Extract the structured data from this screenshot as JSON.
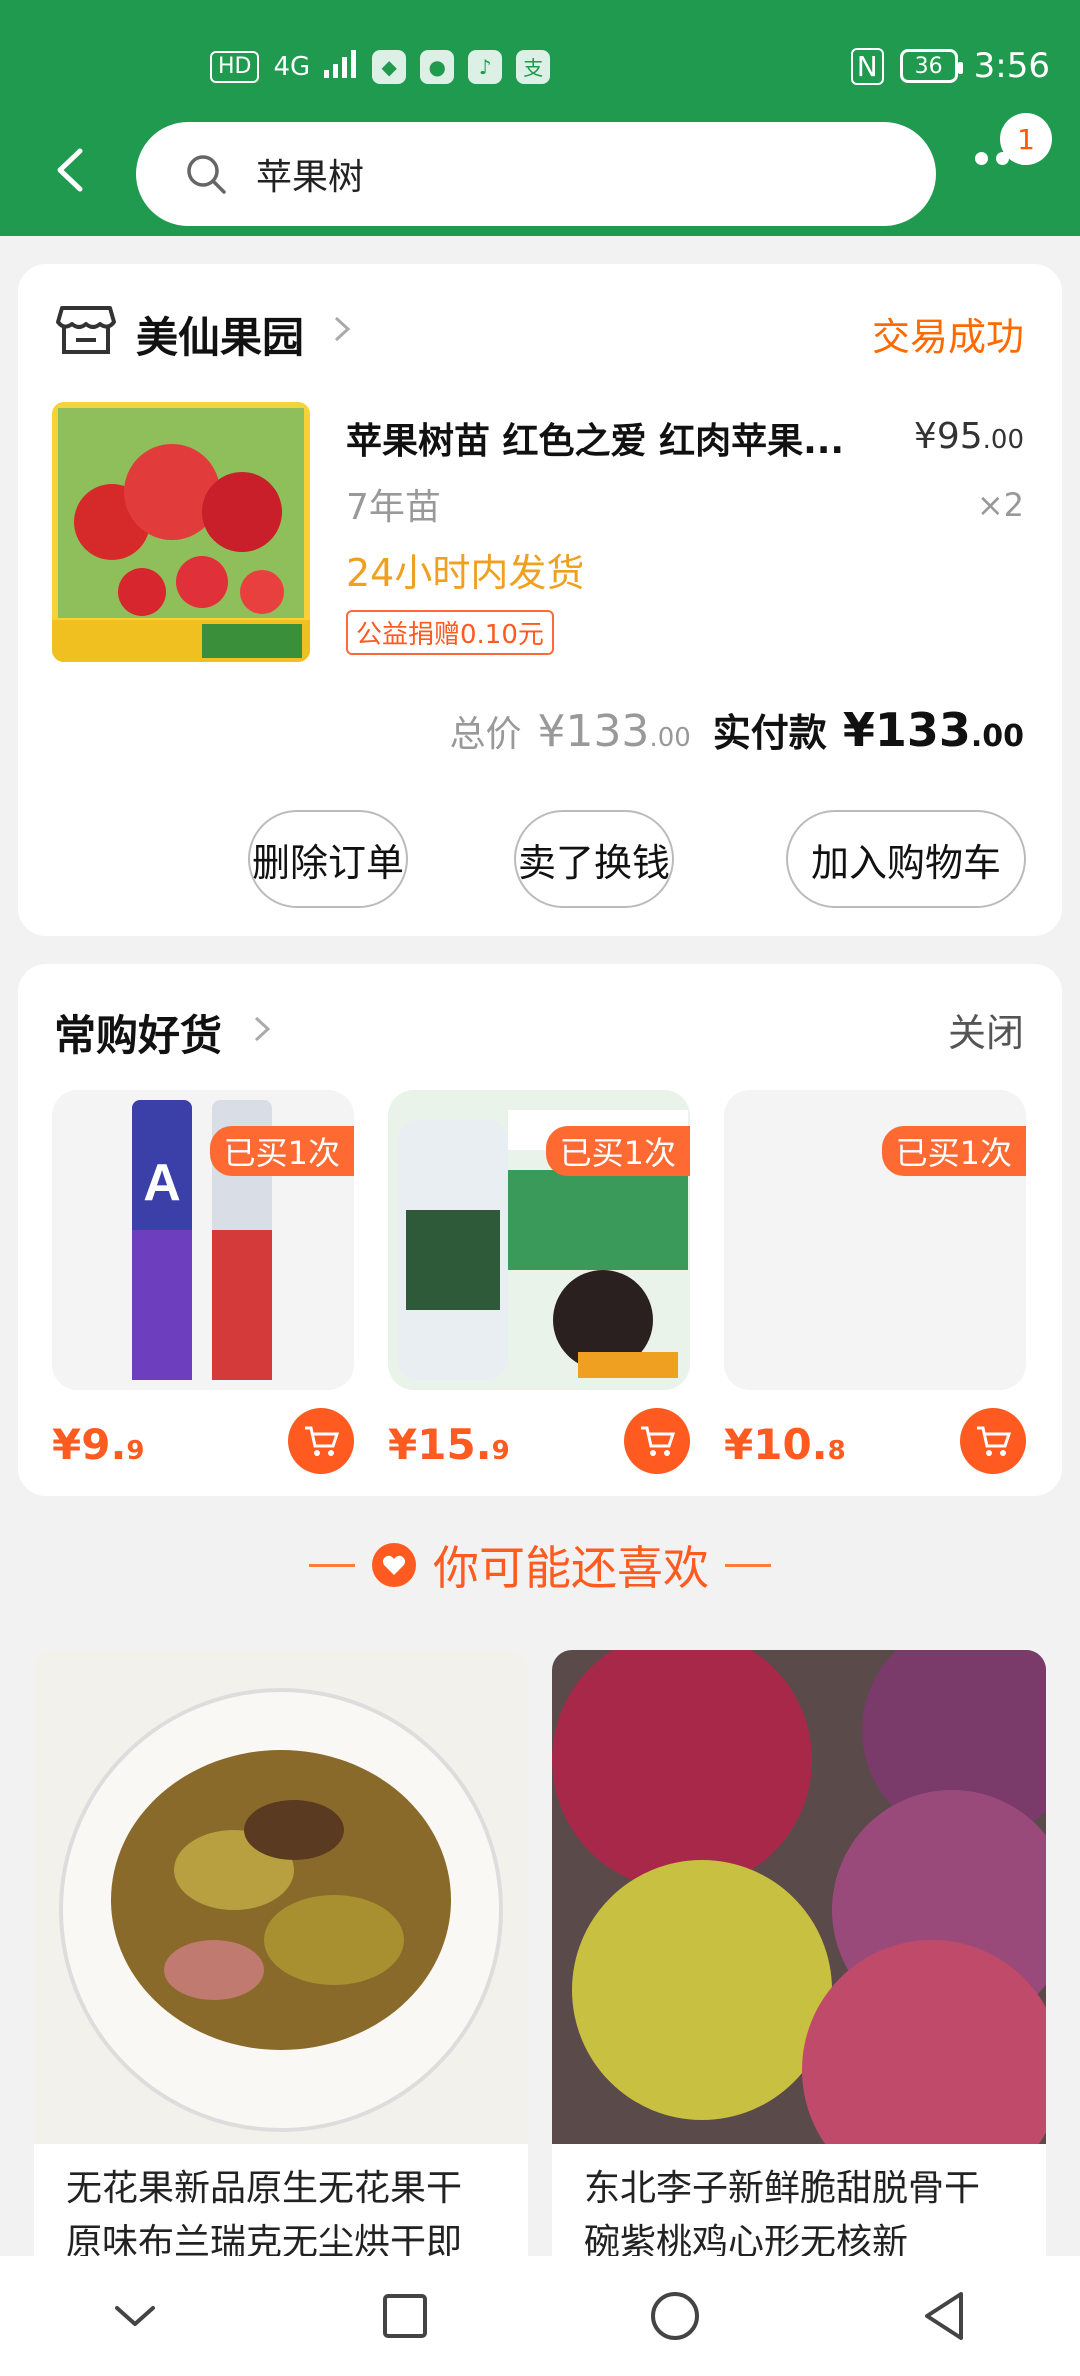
{
  "status_bar": {
    "left_items": [
      "HD",
      "4G",
      "WeChat",
      "Music",
      "Alipay"
    ],
    "battery": "36",
    "time": "3:56"
  },
  "header": {
    "search_text": "苹果树",
    "more_badge": "1"
  },
  "order": {
    "store_name": "美仙果园",
    "status": "交易成功",
    "product_title": "苹果树苗 红色之爱 红肉苹果...",
    "price_main": "¥95",
    "price_decimal": ".00",
    "spec": "7年苗",
    "quantity": "×2",
    "shipping": "24小时内发货",
    "donation": "公益捐赠0.10元",
    "total_label": "总价",
    "total_main": "¥133",
    "total_decimal": ".00",
    "paid_label": "实付款",
    "paid_main": "¥133",
    "paid_decimal": ".00",
    "buttons": [
      "删除订单",
      "卖了换钱",
      "加入购物车"
    ]
  },
  "frequent": {
    "title": "常购好货",
    "close_label": "关闭",
    "items": [
      {
        "badge": "已买1次",
        "price_main": "¥9.",
        "price_decimal": "9"
      },
      {
        "badge": "已买1次",
        "price_main": "¥15.",
        "price_decimal": "9"
      },
      {
        "badge": "已买1次",
        "price_main": "¥10.",
        "price_decimal": "8"
      }
    ]
  },
  "recommend": {
    "title": "你可能还喜欢",
    "items": [
      {
        "text": "无花果新品原生无花果干原味布兰瑞克无尘烘干即"
      },
      {
        "text": "东北李子新鲜脆甜脱骨干碗紫桃鸡心形无核新"
      }
    ]
  },
  "colors": {
    "header_green": "#1f9a4f",
    "accent_orange": "#ff5a1f",
    "status_orange": "#ff6a00"
  }
}
